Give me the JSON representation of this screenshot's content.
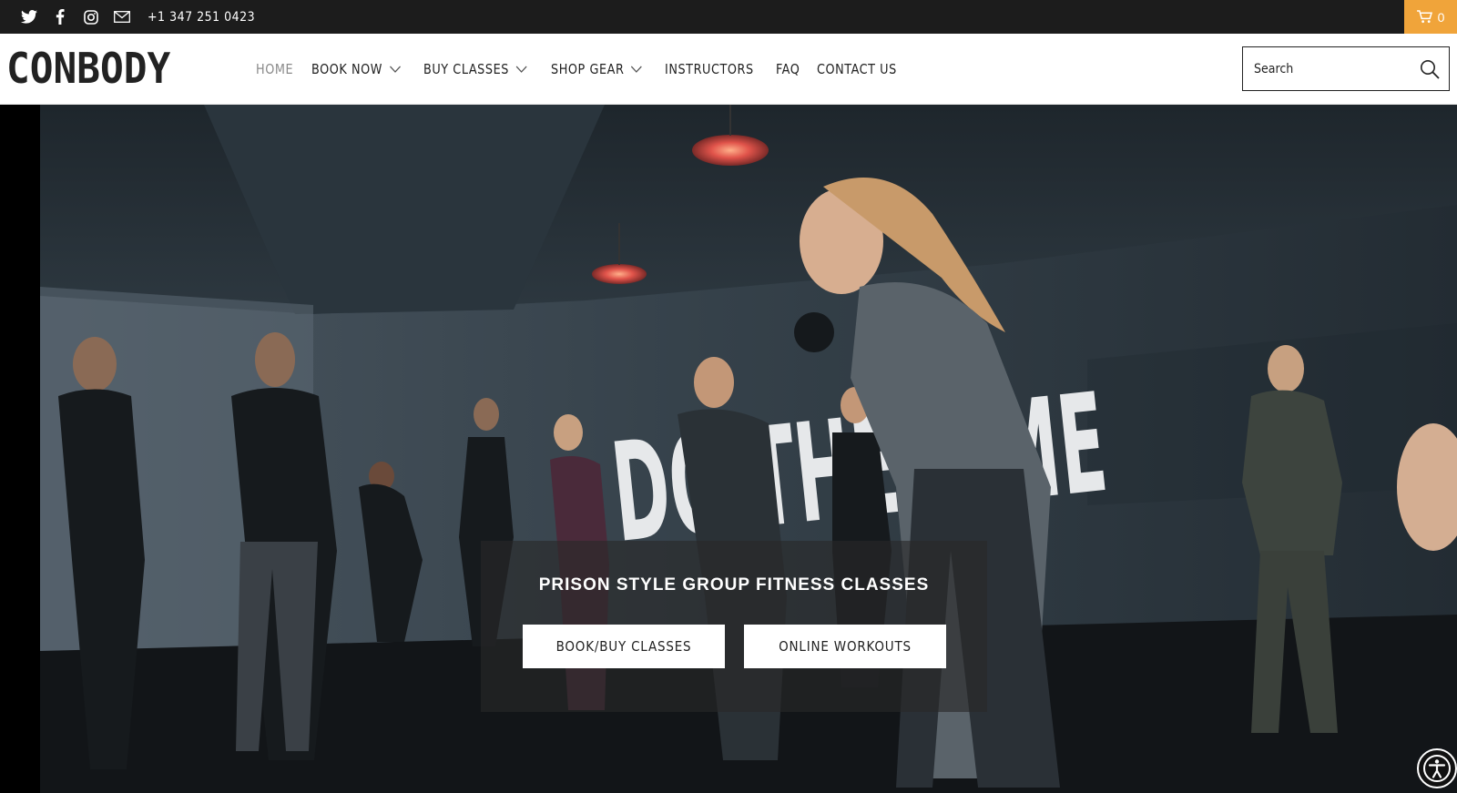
{
  "topbar": {
    "social_icons": [
      "twitter-icon",
      "facebook-icon",
      "instagram-icon",
      "mail-icon"
    ],
    "phone": "+1 347 251 0423",
    "cart_count": "0",
    "cart_color": "#f0a43a"
  },
  "header": {
    "logo": "CONBODY",
    "nav": [
      {
        "label": "HOME",
        "active": true,
        "dropdown": false
      },
      {
        "label": "BOOK NOW",
        "active": false,
        "dropdown": true
      },
      {
        "label": "BUY CLASSES",
        "active": false,
        "dropdown": true
      },
      {
        "label": "SHOP GEAR",
        "active": false,
        "dropdown": true
      },
      {
        "label": "INSTRUCTORS",
        "active": false,
        "dropdown": false
      },
      {
        "label": "FAQ",
        "active": false,
        "dropdown": false
      },
      {
        "label": "CONTACT US",
        "active": false,
        "dropdown": false
      }
    ],
    "search_placeholder": "Search"
  },
  "hero": {
    "wall_text": "DO THE TIME",
    "tagline": "PRISON STYLE GROUP FITNESS CLASSES",
    "buttons": {
      "book": "BOOK/BUY CLASSES",
      "online": "ONLINE WORKOUTS"
    }
  }
}
